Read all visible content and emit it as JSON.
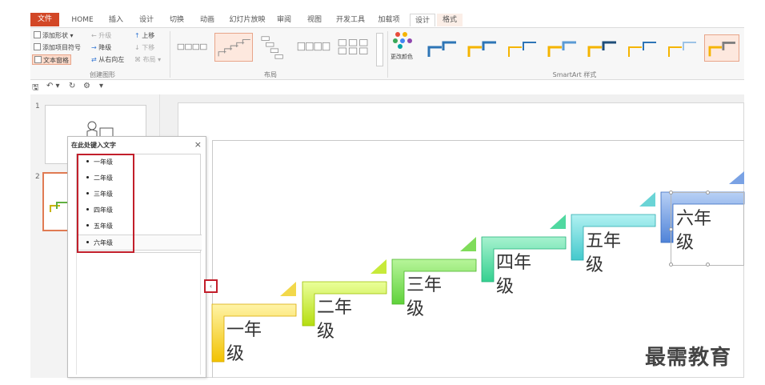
{
  "ribbon_tabs": {
    "file": "文件",
    "home": "HOME",
    "insert": "插入",
    "design": "设计",
    "transitions": "切换",
    "animations": "动画",
    "slideshow": "幻灯片放映",
    "review": "审阅",
    "view": "视图",
    "developer": "开发工具",
    "addins": "加载项",
    "ctx_design": "设计",
    "ctx_format": "格式"
  },
  "create_graphic": {
    "add_shape": "添加形状",
    "add_bullet": "添加项目符号",
    "text_pane": "文本窗格",
    "promote": "升级",
    "demote": "降级",
    "right_to_left": "从右向左",
    "move_up": "上移",
    "move_down": "下移",
    "layout": "布局",
    "group_label": "创建图形"
  },
  "layouts": {
    "group_label": "布局"
  },
  "styles": {
    "change_colors": "更改颜色",
    "group_label": "SmartArt 样式"
  },
  "thumbnails": {
    "slide1_number": "1",
    "slide2_number": "2"
  },
  "text_pane": {
    "title": "在此处键入文字",
    "close": "×",
    "items": [
      "一年级",
      "二年级",
      "三年级",
      "四年级",
      "五年级",
      "六年级"
    ]
  },
  "pane_toggle": "‹",
  "steps": [
    "一年级",
    "二年级",
    "三年级",
    "四年级",
    "五年级",
    "六年级"
  ],
  "step_colors": [
    "#f2c200",
    "#b5dd10",
    "#5fd23a",
    "#35d090",
    "#44c9cc",
    "#4f83d8"
  ],
  "accent": "#d24726",
  "annotation_color": "#c21f2b",
  "watermark": "最需教育"
}
